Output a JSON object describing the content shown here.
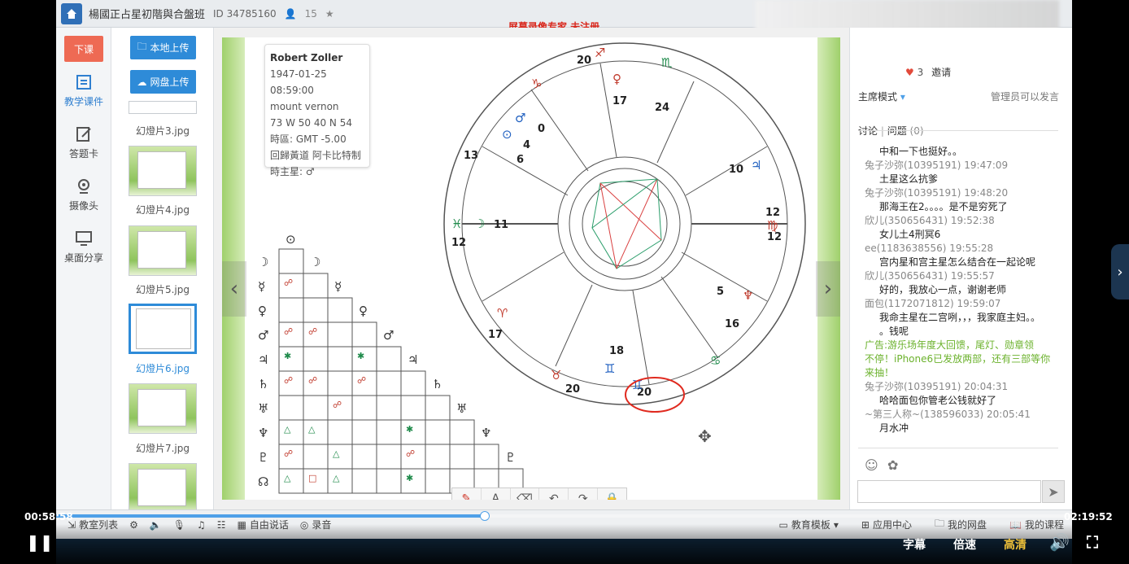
{
  "titlebar": {
    "title": "楊國正占星初階與合盤班",
    "id_label": "ID 34785160",
    "count": "15"
  },
  "watermark": "屏幕录像专家 未注册",
  "leftcol": {
    "end_class": "下课",
    "tools": [
      "教学课件",
      "答题卡",
      "摄像头",
      "桌面分享"
    ]
  },
  "thumbs": {
    "upload_local": "本地上传",
    "upload_cloud": "网盘上传",
    "items": [
      "幻燈片3.jpg",
      "幻燈片4.jpg",
      "幻燈片5.jpg",
      "幻燈片6.jpg",
      "幻燈片7.jpg"
    ]
  },
  "chart_info": {
    "name": "Robert Zoller",
    "datetime": "1947-01-25 08:59:00",
    "place": "mount vernon",
    "coords": "73 W 50  40 N 54",
    "tz": "時區: GMT -5.00",
    "system": "回歸黃道 阿卡比特制",
    "ruler": "時主星: ♂"
  },
  "drawtools": [
    "✎",
    "A",
    "⌫",
    "↶",
    "↷",
    "🔒"
  ],
  "right": {
    "likes": "3",
    "invite": "邀请",
    "mode": "主席模式",
    "admin_note": "管理员可以发言",
    "tab_discuss": "讨论",
    "tab_question": "问题",
    "question_count": "(0)",
    "messages": [
      {
        "type": "msg",
        "text": "中和一下也挺好。。"
      },
      {
        "type": "name",
        "text": "兔子沙弥(10395191) 19:47:09"
      },
      {
        "type": "msg",
        "text": "土星这么抗爹"
      },
      {
        "type": "name",
        "text": "兔子沙弥(10395191) 19:48:20"
      },
      {
        "type": "msg",
        "text": "那海王在2。。。。是不是穷死了"
      },
      {
        "type": "name",
        "text": "欣儿(350656431) 19:52:38"
      },
      {
        "type": "msg",
        "text": "女儿土4刑冥6"
      },
      {
        "type": "name",
        "text": "ee(1183638556) 19:55:28"
      },
      {
        "type": "msg",
        "text": "宫内星和宫主星怎么结合在一起论呢"
      },
      {
        "type": "name",
        "text": "欣儿(350656431) 19:55:57"
      },
      {
        "type": "msg",
        "text": "好的，我放心一点，谢谢老师"
      },
      {
        "type": "name",
        "text": "面包(1172071812) 19:59:07"
      },
      {
        "type": "msg",
        "text": "我命主星在二宫咧，，，我家庭主妇。。"
      },
      {
        "type": "msg",
        "text": "。钱呢"
      },
      {
        "type": "ad",
        "text": "广告:游乐场年度大回馈，尾灯、勋章领"
      },
      {
        "type": "ad",
        "text": "不停！iPhone6已发放两部，还有三部等你"
      },
      {
        "type": "ad",
        "text": "来抽！"
      },
      {
        "type": "name",
        "text": "兔子沙弥(10395191) 20:04:31"
      },
      {
        "type": "msg",
        "text": "哈哈面包你管老公钱就好了"
      },
      {
        "type": "name",
        "text": "~第三人称~(138596033) 20:05:41"
      },
      {
        "type": "msg",
        "text": "月水冲"
      }
    ]
  },
  "bottombar": {
    "left": [
      "教室列表",
      "自由说话",
      "录音"
    ],
    "right": [
      "教育模板",
      "应用中心",
      "我的网盘",
      "我的课程"
    ]
  },
  "player": {
    "elapsed": "00:58:58",
    "total": "02:19:52",
    "progress": 0.4216,
    "subtitle": "字幕",
    "speed": "倍速",
    "quality": "高清"
  }
}
